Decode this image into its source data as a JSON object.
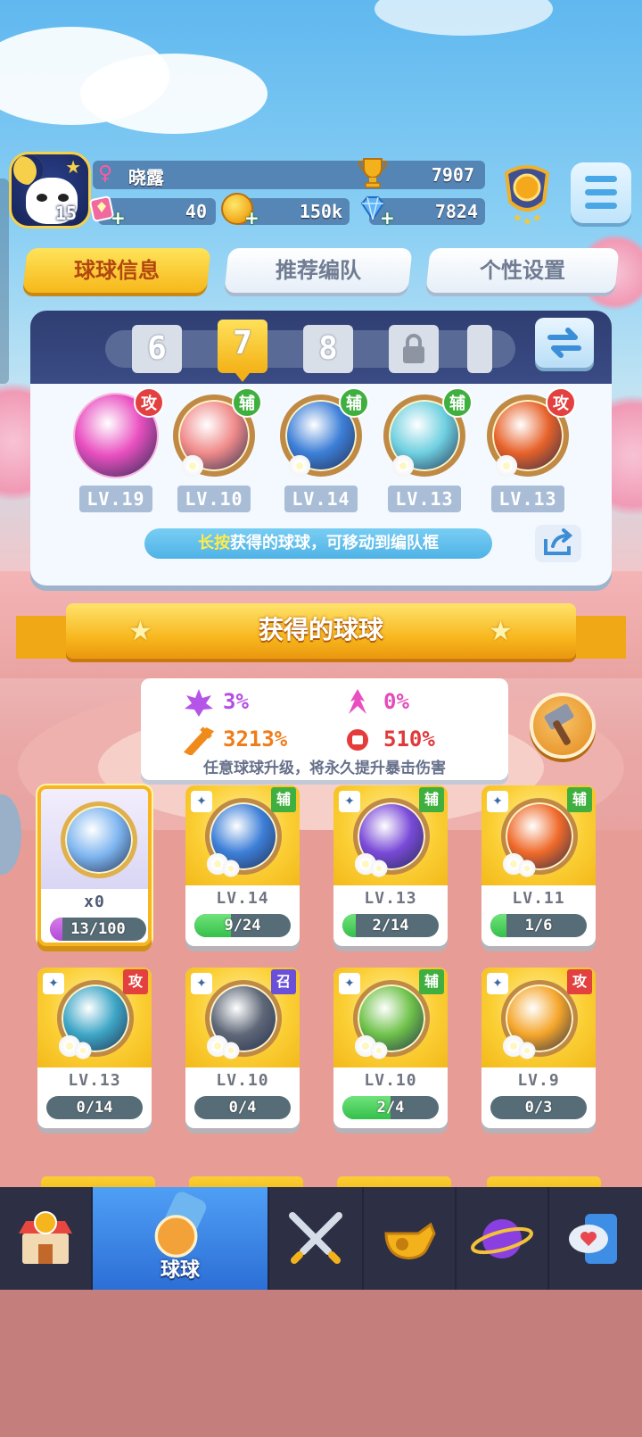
{
  "header": {
    "player_name": "晓露",
    "player_level": "15",
    "trophies": "7907",
    "gems": "40",
    "coins": "150k",
    "diamonds": "7824",
    "rank_stars": 3
  },
  "tabs": [
    {
      "label": "球球信息",
      "active": true
    },
    {
      "label": "推荐编队",
      "active": false
    },
    {
      "label": "个性设置",
      "active": false
    }
  ],
  "team_slots": [
    "6",
    "7",
    "8"
  ],
  "team_slot_active": "7",
  "team_balls": [
    {
      "type_tag": "攻",
      "level": "LV.19",
      "color": "#e94fc0"
    },
    {
      "type_tag": "辅",
      "level": "LV.10",
      "color": "#f08a8a"
    },
    {
      "type_tag": "辅",
      "level": "LV.14",
      "color": "#3d7fd8"
    },
    {
      "type_tag": "辅",
      "level": "LV.13",
      "color": "#6fd0e0"
    },
    {
      "type_tag": "攻",
      "level": "LV.13",
      "color": "#e7622a"
    }
  ],
  "hint": {
    "highlight": "长按",
    "text": "获得的球球，可移动到编队框"
  },
  "banner_title": "获得的球球",
  "crit": {
    "stat1": "3%",
    "stat2": "0%",
    "stat3": "3213%",
    "stat4": "510%",
    "description": "任意球球升级，将永久提升暴击伤害"
  },
  "cards": [
    {
      "special": true,
      "level": "x0",
      "progress": "13/100",
      "fill": 0.13,
      "tag": "",
      "color": "#7fb6f0"
    },
    {
      "special": false,
      "level": "LV.14",
      "progress": "9/24",
      "fill": 0.375,
      "tag": "辅",
      "color": "#3d7fd8"
    },
    {
      "special": false,
      "level": "LV.13",
      "progress": "2/14",
      "fill": 0.143,
      "tag": "辅",
      "color": "#7a4ad8"
    },
    {
      "special": false,
      "level": "LV.11",
      "progress": "1/6",
      "fill": 0.167,
      "tag": "辅",
      "color": "#f06a2a"
    },
    {
      "special": false,
      "level": "LV.13",
      "progress": "0/14",
      "fill": 0,
      "tag": "攻",
      "color": "#3ea6c6"
    },
    {
      "special": false,
      "level": "LV.10",
      "progress": "0/4",
      "fill": 0,
      "tag": "召",
      "color": "#5f6878"
    },
    {
      "special": false,
      "level": "LV.10",
      "progress": "2/4",
      "fill": 0.5,
      "tag": "辅",
      "color": "#6fc24a"
    },
    {
      "special": false,
      "level": "LV.9",
      "progress": "0/3",
      "fill": 0,
      "tag": "攻",
      "color": "#f5a52a"
    }
  ],
  "bottom_nav": [
    {
      "name": "shop",
      "label": "",
      "icon": "shop-icon",
      "active": false
    },
    {
      "name": "balls",
      "label": "球球",
      "icon": "ball-potion-icon",
      "active": true
    },
    {
      "name": "battle",
      "label": "",
      "icon": "crossed-swords-icon",
      "active": false
    },
    {
      "name": "whistle",
      "label": "",
      "icon": "whistle-icon",
      "active": false
    },
    {
      "name": "planet",
      "label": "",
      "icon": "planet-icon",
      "active": false
    },
    {
      "name": "social",
      "label": "",
      "icon": "heart-chat-icon",
      "active": false
    }
  ],
  "colors": {
    "tag_attack": "#e2413f",
    "tag_support": "#3fb03f",
    "tag_summon": "#6a4fd8",
    "accent_yellow": "#f6b81a",
    "nav_active": "#2c6fd6"
  }
}
